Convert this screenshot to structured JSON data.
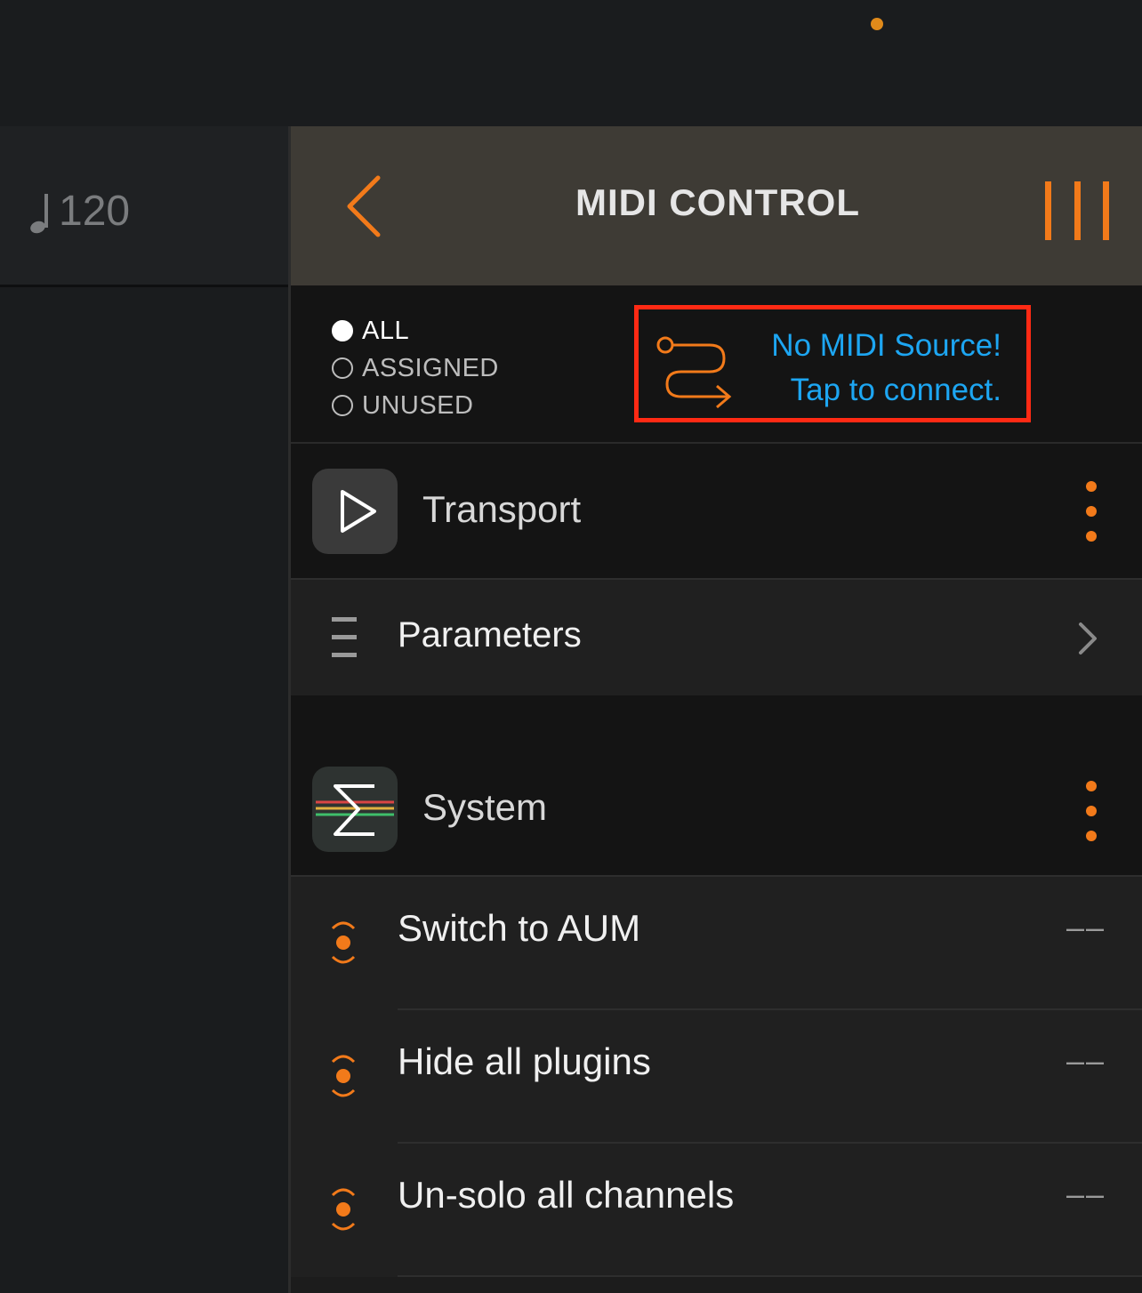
{
  "status": {
    "indicator_color": "#e08a1a"
  },
  "tempo": {
    "icon": "quarter-note-icon",
    "value": "120"
  },
  "header": {
    "title": "MIDI CONTROL",
    "back_icon": "chevron-left-icon",
    "menu_icon": "channel-strips-icon",
    "accent_color": "#f27a1a"
  },
  "filters": {
    "options": [
      {
        "label": "ALL",
        "selected": true
      },
      {
        "label": "ASSIGNED",
        "selected": false
      },
      {
        "label": "UNUSED",
        "selected": false
      }
    ]
  },
  "midi_source": {
    "icon": "midi-route-icon",
    "line1": "No MIDI Source!",
    "line2": "Tap to connect.",
    "text_color": "#1da6f2",
    "highlight_color": "#ff2a14"
  },
  "sections": [
    {
      "title": "Transport",
      "icon": "play-icon",
      "menu_icon": "more-vertical-icon"
    },
    {
      "title": "System",
      "icon": "sigma-icon",
      "menu_icon": "more-vertical-icon"
    }
  ],
  "parameters_row": {
    "label": "Parameters",
    "icon": "list-icon",
    "chevron": "chevron-right-icon"
  },
  "controls": [
    {
      "label": "Switch to AUM",
      "value": "––",
      "icon": "midi-learn-icon"
    },
    {
      "label": "Hide all plugins",
      "value": "––",
      "icon": "midi-learn-icon"
    },
    {
      "label": "Un-solo all channels",
      "value": "––",
      "icon": "midi-learn-icon"
    }
  ]
}
